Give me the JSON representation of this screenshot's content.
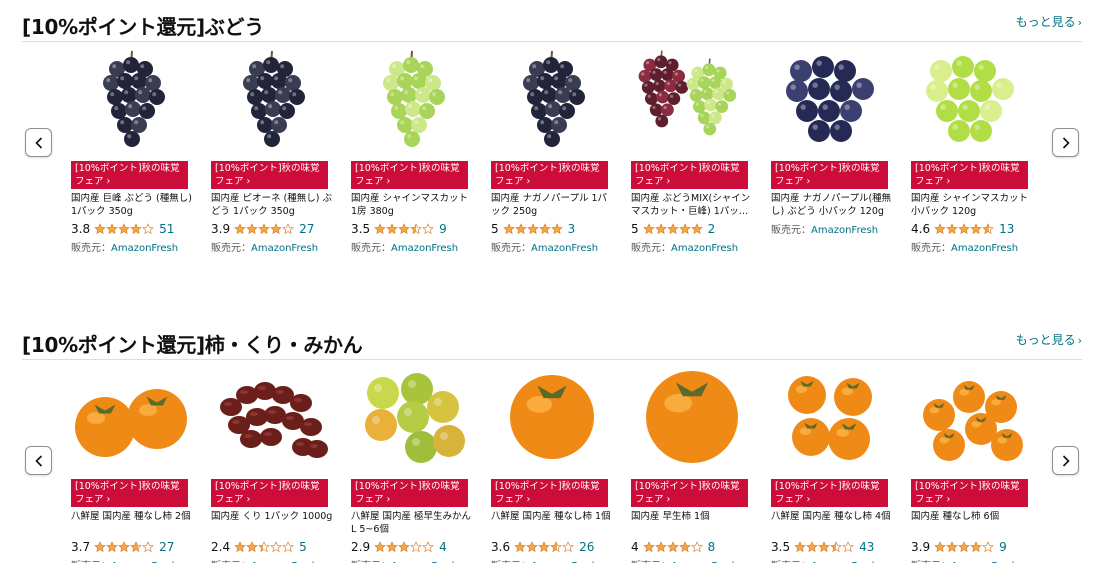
{
  "colors": {
    "accent": "#cc0c39",
    "link": "#007185",
    "star": "#f3a847"
  },
  "sections": [
    {
      "title": "[10%ポイント還元]ぶどう",
      "see_more": "もっと見る",
      "items": [
        {
          "badge": "[10%ポイント]秋の味覚フェア ›",
          "title": "国内産 巨峰 ぶどう (種無し) 1パック 350g",
          "rating": "3.8",
          "rating_value": 3.8,
          "count": "51",
          "seller_label": "販売元：",
          "seller": "AmazonFresh",
          "image": "grapes-dark-icon"
        },
        {
          "badge": "[10%ポイント]秋の味覚フェア ›",
          "title": "国内産 ピオーネ (種無し) ぶどう 1パック 350g",
          "rating": "3.9",
          "rating_value": 3.9,
          "count": "27",
          "seller_label": "販売元：",
          "seller": "AmazonFresh",
          "image": "grapes-dark-icon"
        },
        {
          "badge": "[10%ポイント]秋の味覚フェア ›",
          "title": "国内産 シャインマスカット 1房 380g",
          "rating": "3.5",
          "rating_value": 3.5,
          "count": "9",
          "seller_label": "販売元：",
          "seller": "AmazonFresh",
          "image": "grapes-green-icon"
        },
        {
          "badge": "[10%ポイント]秋の味覚フェア ›",
          "title": "国内産 ナガノパープル 1パック 250g",
          "rating": "5",
          "rating_value": 5,
          "count": "3",
          "seller_label": "販売元：",
          "seller": "AmazonFresh",
          "image": "grapes-dark-icon"
        },
        {
          "badge": "[10%ポイント]秋の味覚フェア ›",
          "title": "国内産 ぶどうMIX(シャインマスカット・巨峰) 1パッ…",
          "rating": "5",
          "rating_value": 5,
          "count": "2",
          "seller_label": "販売元：",
          "seller": "AmazonFresh",
          "image": "grapes-mix-icon"
        },
        {
          "badge": "[10%ポイント]秋の味覚フェア ›",
          "title": "国内産 ナガノパープル(種無し) ぶどう 小パック 120g",
          "rating": "",
          "rating_value": null,
          "count": "",
          "seller_label": "販売元：",
          "seller": "AmazonFresh",
          "image": "grapes-dark-loose-icon"
        },
        {
          "badge": "[10%ポイント]秋の味覚フェア ›",
          "title": "国内産 シャインマスカット 小パック 120g",
          "rating": "4.6",
          "rating_value": 4.6,
          "count": "13",
          "seller_label": "販売元：",
          "seller": "AmazonFresh",
          "image": "grapes-green-loose-icon"
        }
      ]
    },
    {
      "title": "[10%ポイント還元]柿・くり・みかん",
      "see_more": "もっと見る",
      "items": [
        {
          "badge": "[10%ポイント]秋の味覚フェア ›",
          "title": "八鮮屋 国内産 種なし柿 2個",
          "rating": "3.7",
          "rating_value": 3.7,
          "count": "27",
          "seller_label": "販売元：",
          "seller": "AmazonFresh",
          "image": "persimmon-two-icon"
        },
        {
          "badge": "[10%ポイント]秋の味覚フェア ›",
          "title": "国内産 くり 1パック 1000g",
          "rating": "2.4",
          "rating_value": 2.4,
          "count": "5",
          "seller_label": "販売元：",
          "seller": "AmazonFresh",
          "image": "chestnut-icon"
        },
        {
          "badge": "[10%ポイント]秋の味覚フェア ›",
          "title": "八鮮屋 国内産 極早生みかんL 5~6個",
          "rating": "2.9",
          "rating_value": 2.9,
          "count": "4",
          "seller_label": "販売元：",
          "seller": "AmazonFresh",
          "image": "mikan-icon"
        },
        {
          "badge": "[10%ポイント]秋の味覚フェア ›",
          "title": "八鮮屋 国内産 種なし柿 1個",
          "rating": "3.6",
          "rating_value": 3.6,
          "count": "26",
          "seller_label": "販売元：",
          "seller": "AmazonFresh",
          "image": "persimmon-one-icon"
        },
        {
          "badge": "[10%ポイント]秋の味覚フェア ›",
          "title": "国内産 早生柿 1個",
          "rating": "4",
          "rating_value": 4,
          "count": "8",
          "seller_label": "販売元：",
          "seller": "AmazonFresh",
          "image": "persimmon-one-large-icon"
        },
        {
          "badge": "[10%ポイント]秋の味覚フェア ›",
          "title": "八鮮屋 国内産 種なし柿 4個",
          "rating": "3.5",
          "rating_value": 3.5,
          "count": "43",
          "seller_label": "販売元：",
          "seller": "AmazonFresh",
          "image": "persimmon-four-icon"
        },
        {
          "badge": "[10%ポイント]秋の味覚フェア ›",
          "title": "国内産 種なし柿 6個",
          "rating": "3.9",
          "rating_value": 3.9,
          "count": "9",
          "seller_label": "販売元：",
          "seller": "AmazonFresh",
          "image": "persimmon-six-icon"
        }
      ]
    }
  ]
}
